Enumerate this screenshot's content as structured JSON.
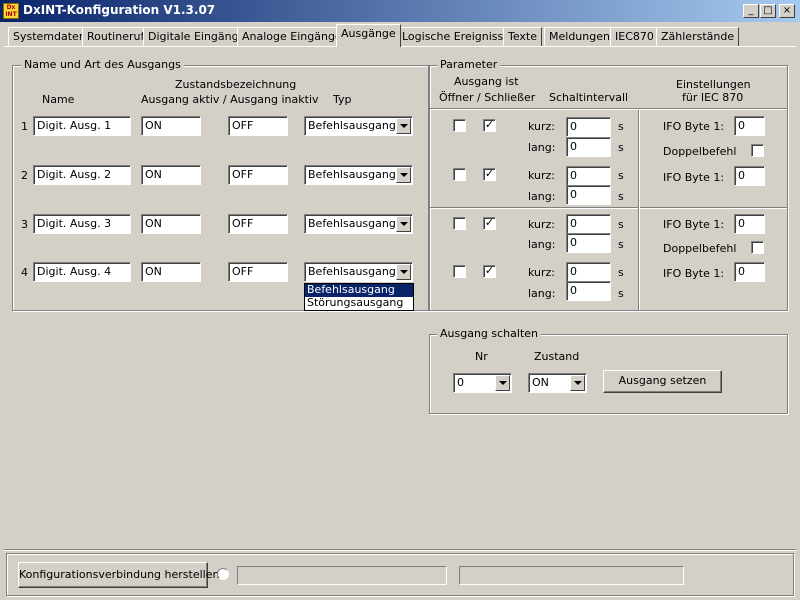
{
  "window": {
    "title": "DxINT-Konfiguration V1.3.07",
    "minimize": "_",
    "maximize": "□",
    "close": "×"
  },
  "tabs": [
    "Systemdaten",
    "Routineruf",
    "Digitale Eingänge",
    "Analoge Eingänge",
    "Ausgänge",
    "Logische Ereignisse",
    "Texte",
    "Meldungen",
    "IEC870",
    "Zählerstände"
  ],
  "outputs_group": {
    "title": "Name und Art des Ausgangs",
    "col_name": "Name",
    "col_state_header": "Zustandsbezeichnung",
    "col_state_sub": "Ausgang aktiv / Ausgang inaktiv",
    "col_type": "Typ",
    "rows": [
      {
        "nr": "1",
        "name": "Digit. Ausg. 1",
        "active": "ON",
        "inactive": "OFF",
        "type": "Befehlsausgang"
      },
      {
        "nr": "2",
        "name": "Digit. Ausg. 2",
        "active": "ON",
        "inactive": "OFF",
        "type": "Befehlsausgang"
      },
      {
        "nr": "3",
        "name": "Digit. Ausg. 3",
        "active": "ON",
        "inactive": "OFF",
        "type": "Befehlsausgang"
      },
      {
        "nr": "4",
        "name": "Digit. Ausg. 4",
        "active": "ON",
        "inactive": "OFF",
        "type": "Befehlsausgang"
      }
    ],
    "type_options": [
      "Befehlsausgang",
      "Störungsausgang"
    ]
  },
  "params_group": {
    "title": "Parameter",
    "hdr_ausgang_ist": "Ausgang ist",
    "hdr_oeffner_schliesser": "Öffner / Schließer",
    "hdr_schaltintervall": "Schaltintervall",
    "hdr_einstellungen": "Einstellungen",
    "hdr_fuer_iec": "für IEC 870",
    "kurz": "kurz:",
    "lang": "lang:",
    "unit": "s",
    "ifo_label": "IFO Byte 1:",
    "doppel_label": "Doppelbefehl",
    "check_mark": "✓",
    "rows": [
      {
        "oeffner": false,
        "schliesser": true,
        "kurz": "0",
        "lang": "0"
      },
      {
        "oeffner": false,
        "schliesser": true,
        "kurz": "0",
        "lang": "0"
      },
      {
        "oeffner": false,
        "schliesser": true,
        "kurz": "0",
        "lang": "0"
      },
      {
        "oeffner": false,
        "schliesser": true,
        "kurz": "0",
        "lang": "0"
      }
    ],
    "iec_blocks": [
      {
        "ifo1": "0",
        "doppel": false,
        "ifo2": "0"
      },
      {
        "ifo1": "0",
        "doppel": false,
        "ifo2": "0"
      }
    ]
  },
  "switch_group": {
    "title": "Ausgang schalten",
    "nr_label": "Nr",
    "state_label": "Zustand",
    "nr_value": "0",
    "state_value": "ON",
    "button": "Ausgang setzen"
  },
  "footer": {
    "connect_button": "Konfigurationsverbindung herstellen",
    "status1": "",
    "status2": ""
  }
}
